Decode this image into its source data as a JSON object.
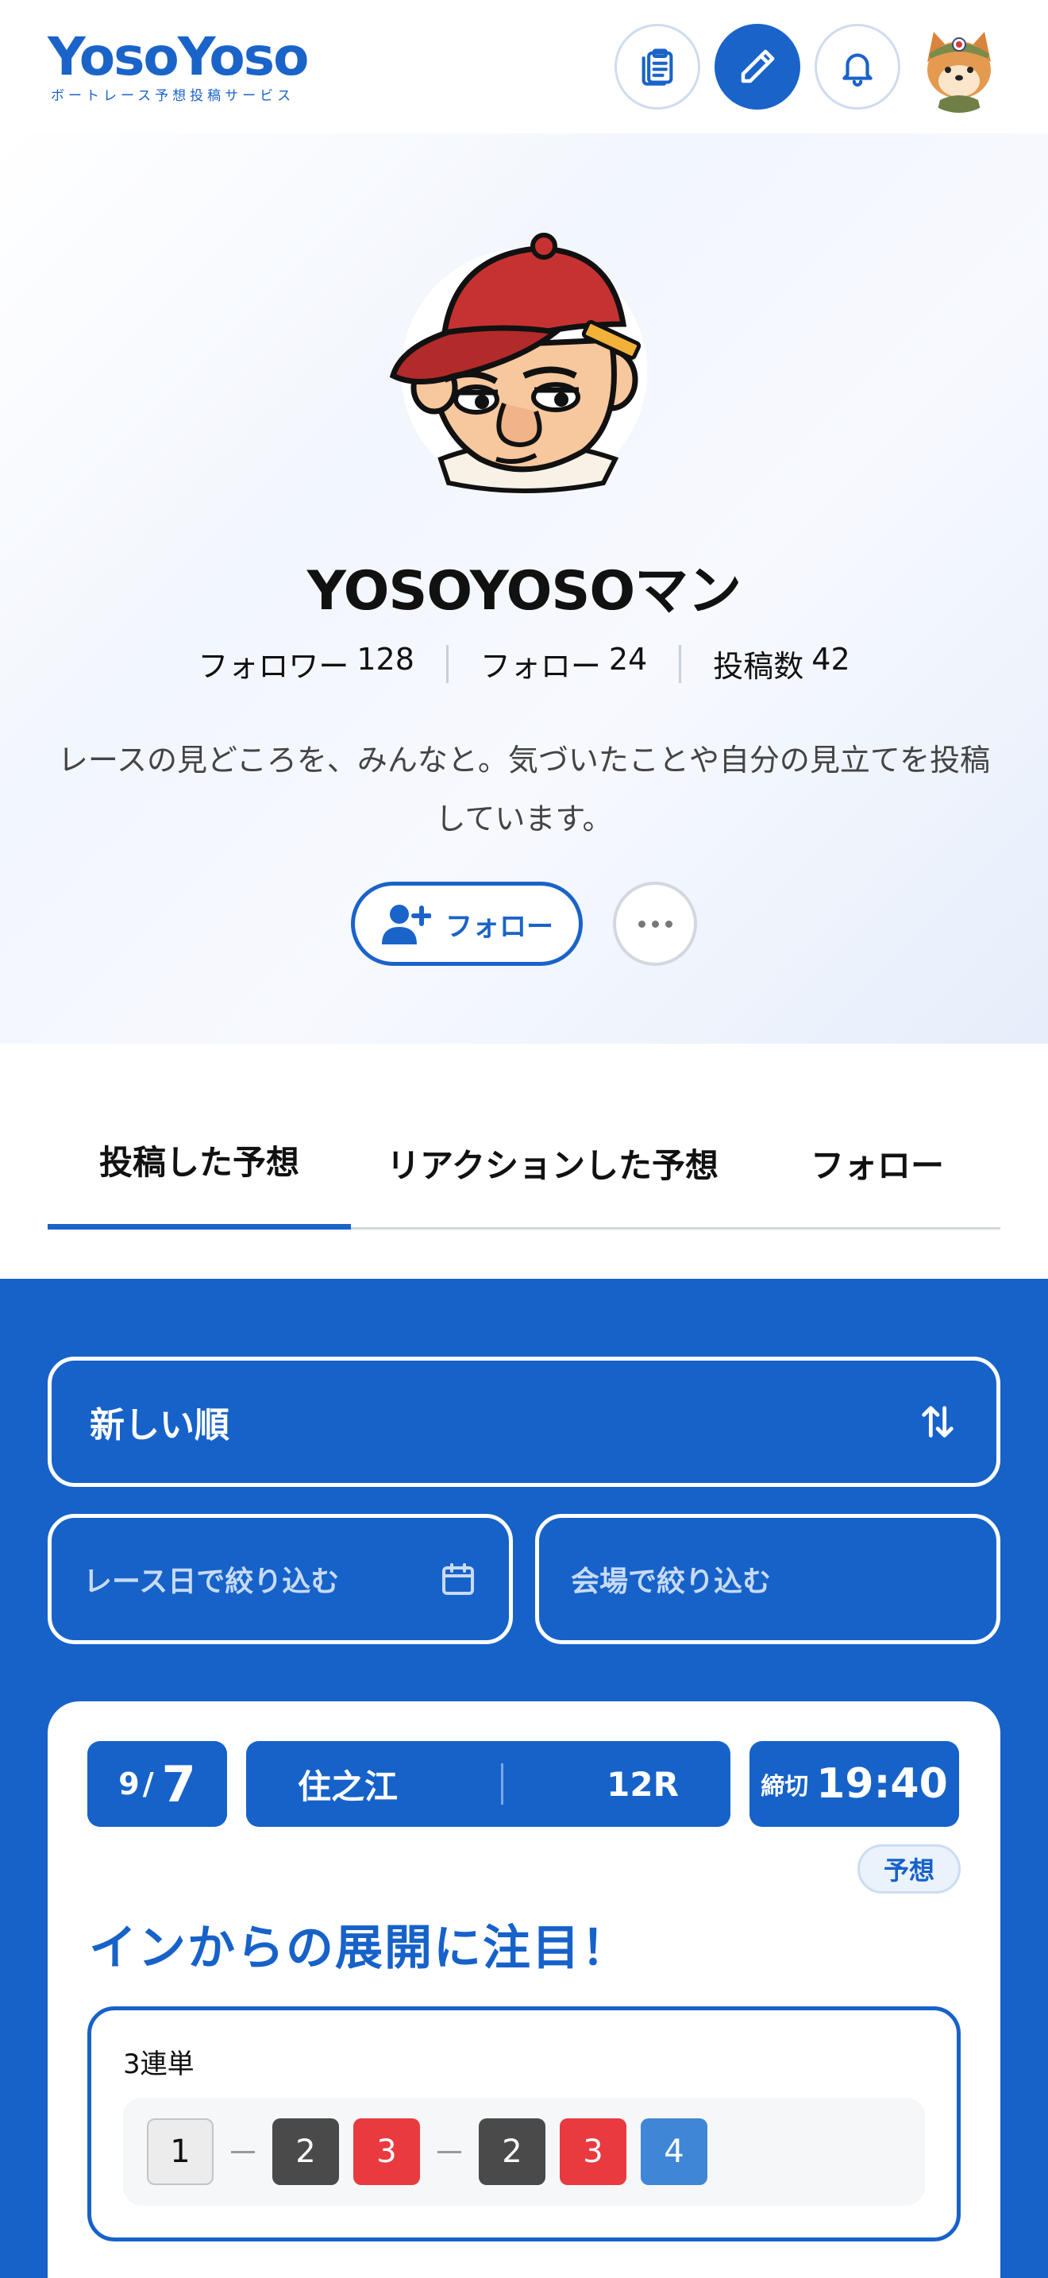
{
  "header": {
    "logo_text": "YosoYoso",
    "logo_subtitle": "ボートレース予想投稿サービス",
    "icons": [
      "clipboard-icon",
      "pencil-icon",
      "bell-icon",
      "user-avatar-icon"
    ]
  },
  "profile": {
    "name": "YOSOYOSOマン",
    "stats": [
      {
        "label": "フォロワー",
        "value": "128"
      },
      {
        "label": "フォロー",
        "value": "24"
      },
      {
        "label": "投稿数",
        "value": "42"
      }
    ],
    "bio": "レースの見どころを、みんなと。気づいたことや自分の見立てを投稿しています。",
    "follow_label": "フォロー"
  },
  "tabs": [
    {
      "label": "投稿した予想",
      "active": true
    },
    {
      "label": "リアクションした予想",
      "active": false
    },
    {
      "label": "フォロー",
      "active": false
    }
  ],
  "filters": {
    "sort_label": "新しい順",
    "date_placeholder": "レース日で絞り込む",
    "venue_placeholder": "会場で絞り込む"
  },
  "card": {
    "month": "9",
    "day": "7",
    "venue": "住之江",
    "race": "12R",
    "deadline_label": "締切",
    "deadline_time": "19:40",
    "badge": "予想",
    "title": "インからの展開に注目！",
    "bet_type": "3連単",
    "picks": {
      "first": [
        "1"
      ],
      "second": [
        "2",
        "3"
      ],
      "third": [
        "2",
        "3",
        "4"
      ]
    }
  },
  "colors": {
    "brand_blue": "#1a63c9",
    "boat_1": "#ececec",
    "boat_2": "#4a4a4a",
    "boat_3": "#e83a3f",
    "boat_4": "#3f86d6"
  }
}
